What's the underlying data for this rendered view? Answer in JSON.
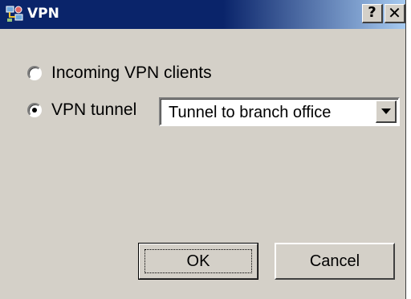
{
  "window": {
    "title": "VPN",
    "icon": "vpn-network-icon",
    "help_label": "?",
    "close_label": "✕"
  },
  "options": {
    "incoming_label": "Incoming VPN clients",
    "incoming_selected": false,
    "tunnel_label": "VPN tunnel",
    "tunnel_selected": true
  },
  "tunnel_select": {
    "value": "Tunnel to branch office"
  },
  "buttons": {
    "ok_label": "OK",
    "cancel_label": "Cancel"
  },
  "colors": {
    "titlebar": "#0a246a",
    "face": "#d4d0c8"
  }
}
